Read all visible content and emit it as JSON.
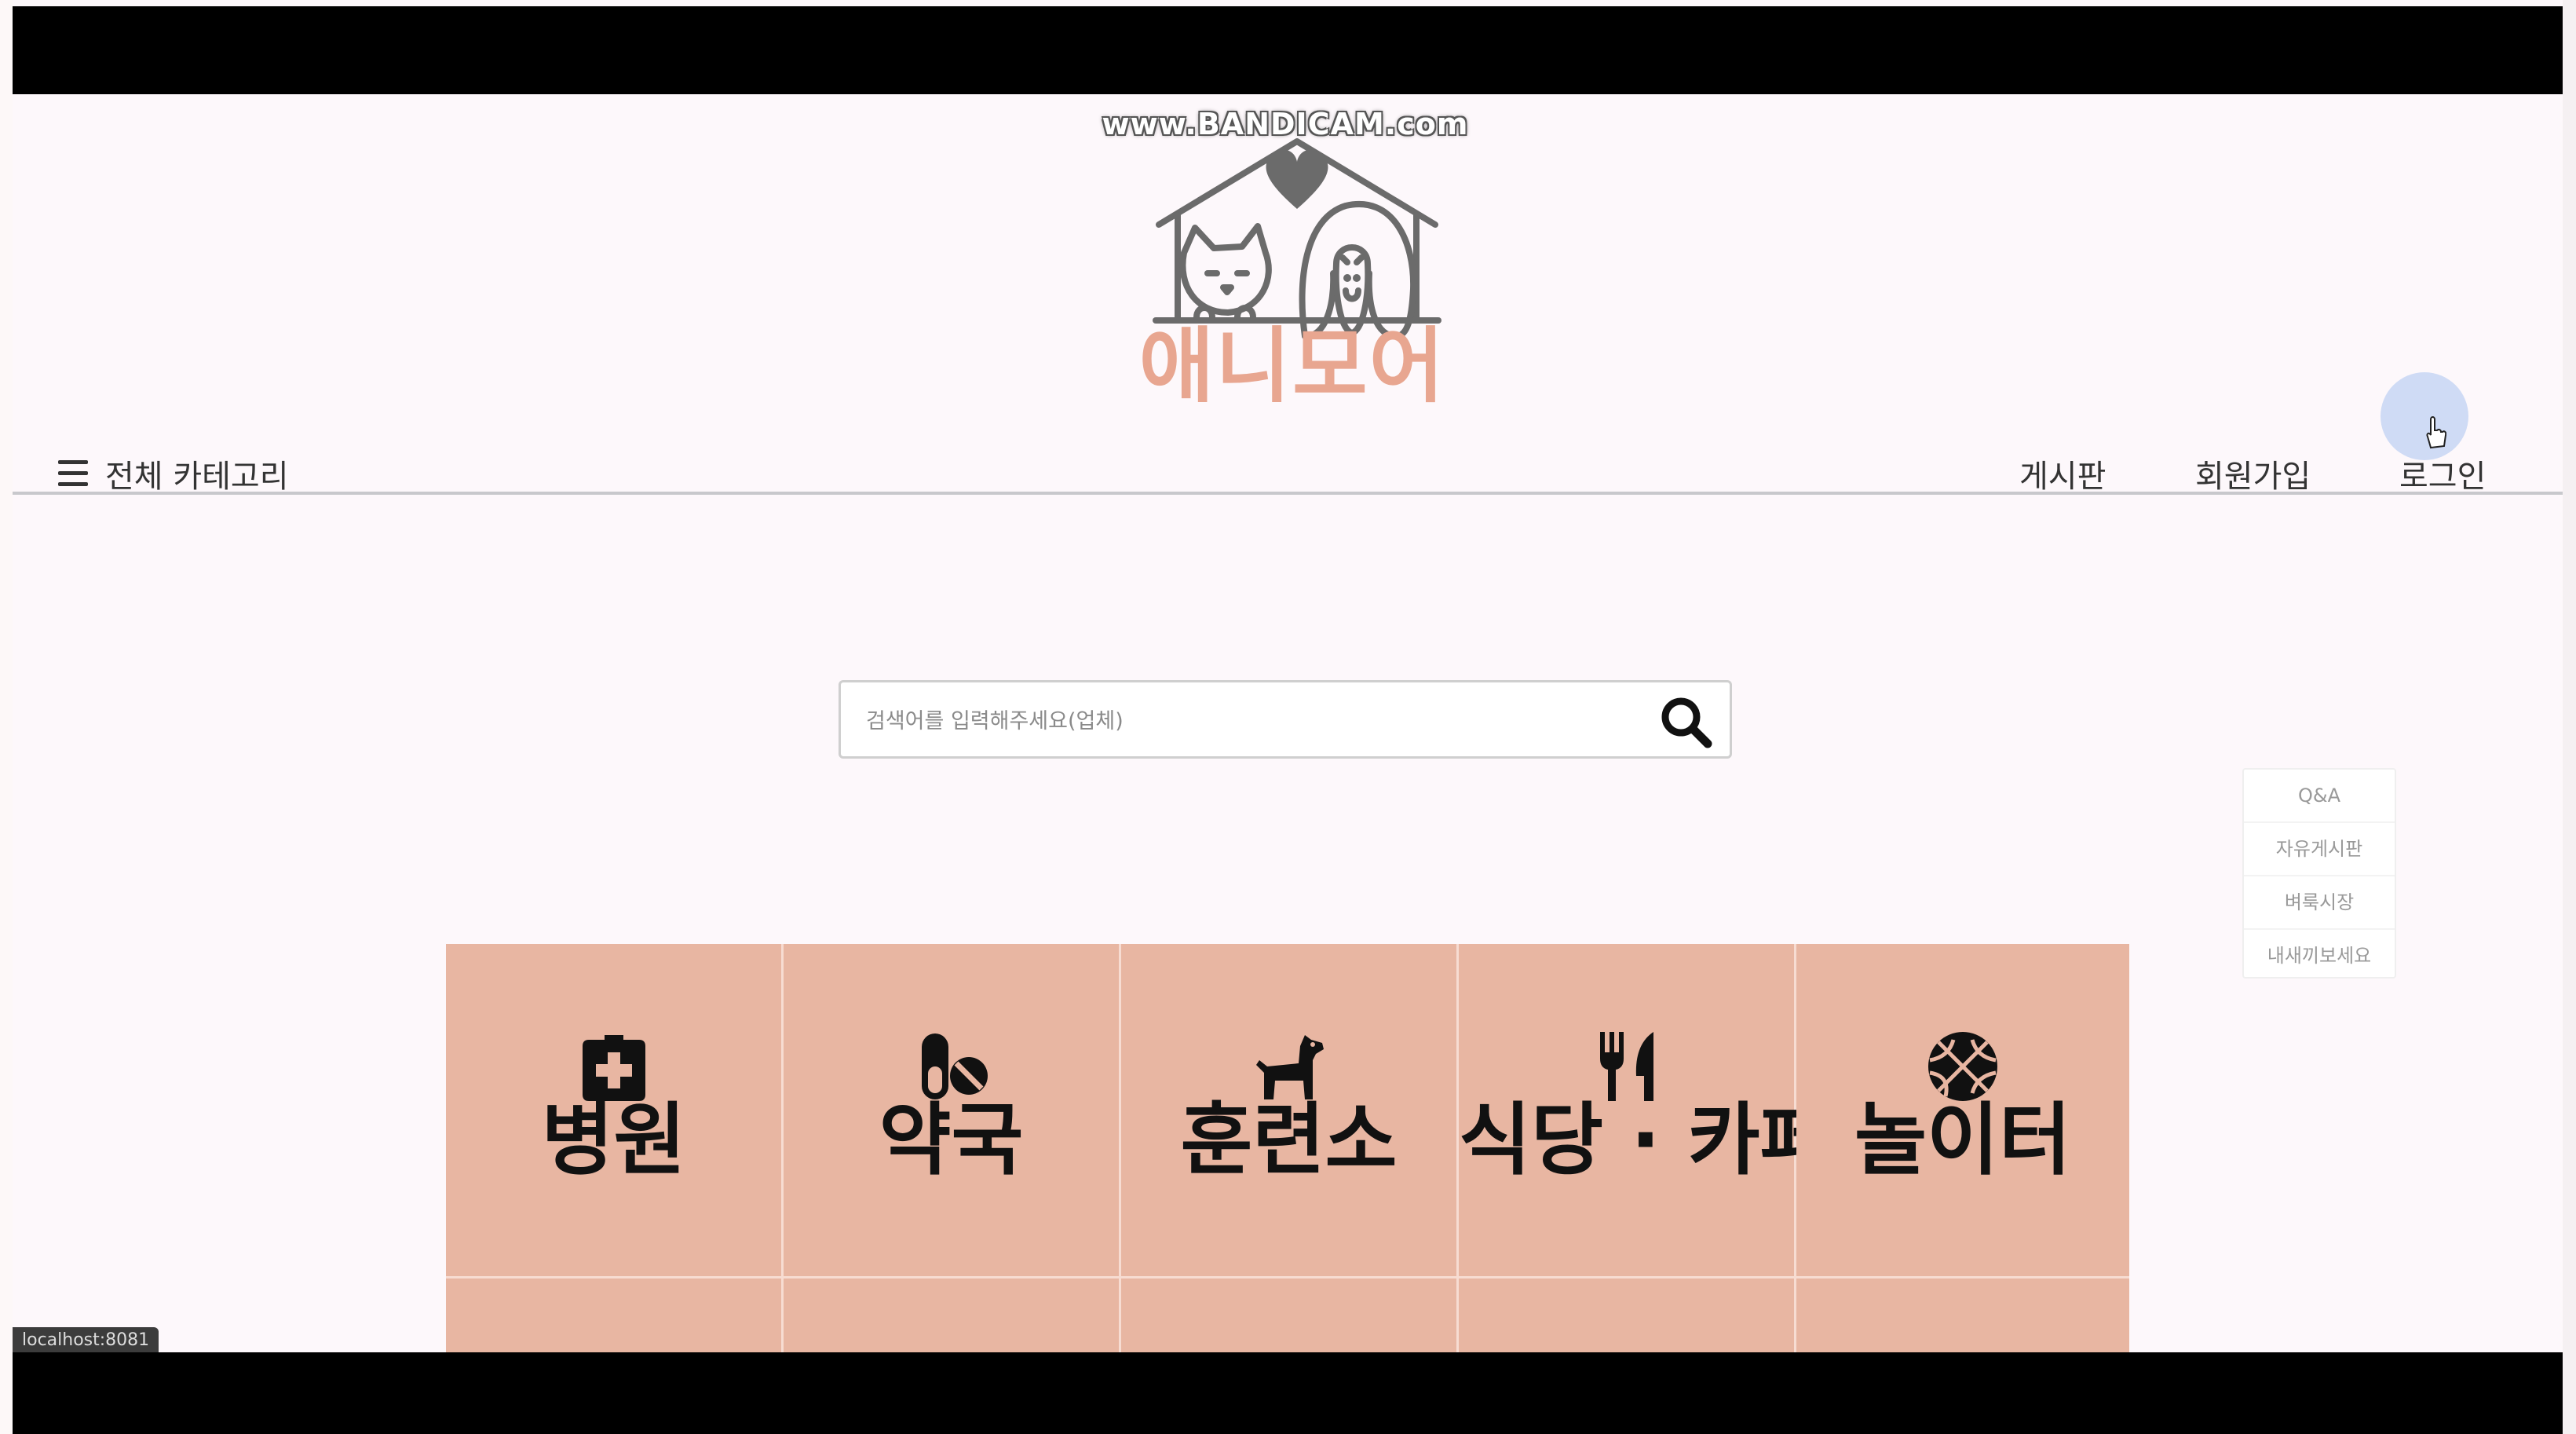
{
  "watermark": "www.BANDICAM.com",
  "brand": {
    "name": "애니모어",
    "color": "#e8a690"
  },
  "nav": {
    "all_categories": "전체 카테고리",
    "links": {
      "board": "게시판",
      "signup": "회원가입",
      "login": "로그인"
    }
  },
  "search": {
    "placeholder": "검색어를 입력해주세요(업체)",
    "icon": "search-icon"
  },
  "quick_menu": [
    "Q&A",
    "자유게시판",
    "벼룩시장",
    "내새끼보세요"
  ],
  "categories": [
    {
      "label": "병원",
      "icon": "hospital-plus-icon"
    },
    {
      "label": "약국",
      "icon": "pills-icon"
    },
    {
      "label": "훈련소",
      "icon": "dog-icon"
    },
    {
      "label": "식당 · 카페",
      "icon": "utensils-icon"
    },
    {
      "label": "놀이터",
      "icon": "basketball-icon"
    }
  ],
  "colors": {
    "tile": "#e8b6a2",
    "tile_border": "#f7dcd2",
    "letterbox": "#000000"
  },
  "status_bar": "localhost:8081"
}
